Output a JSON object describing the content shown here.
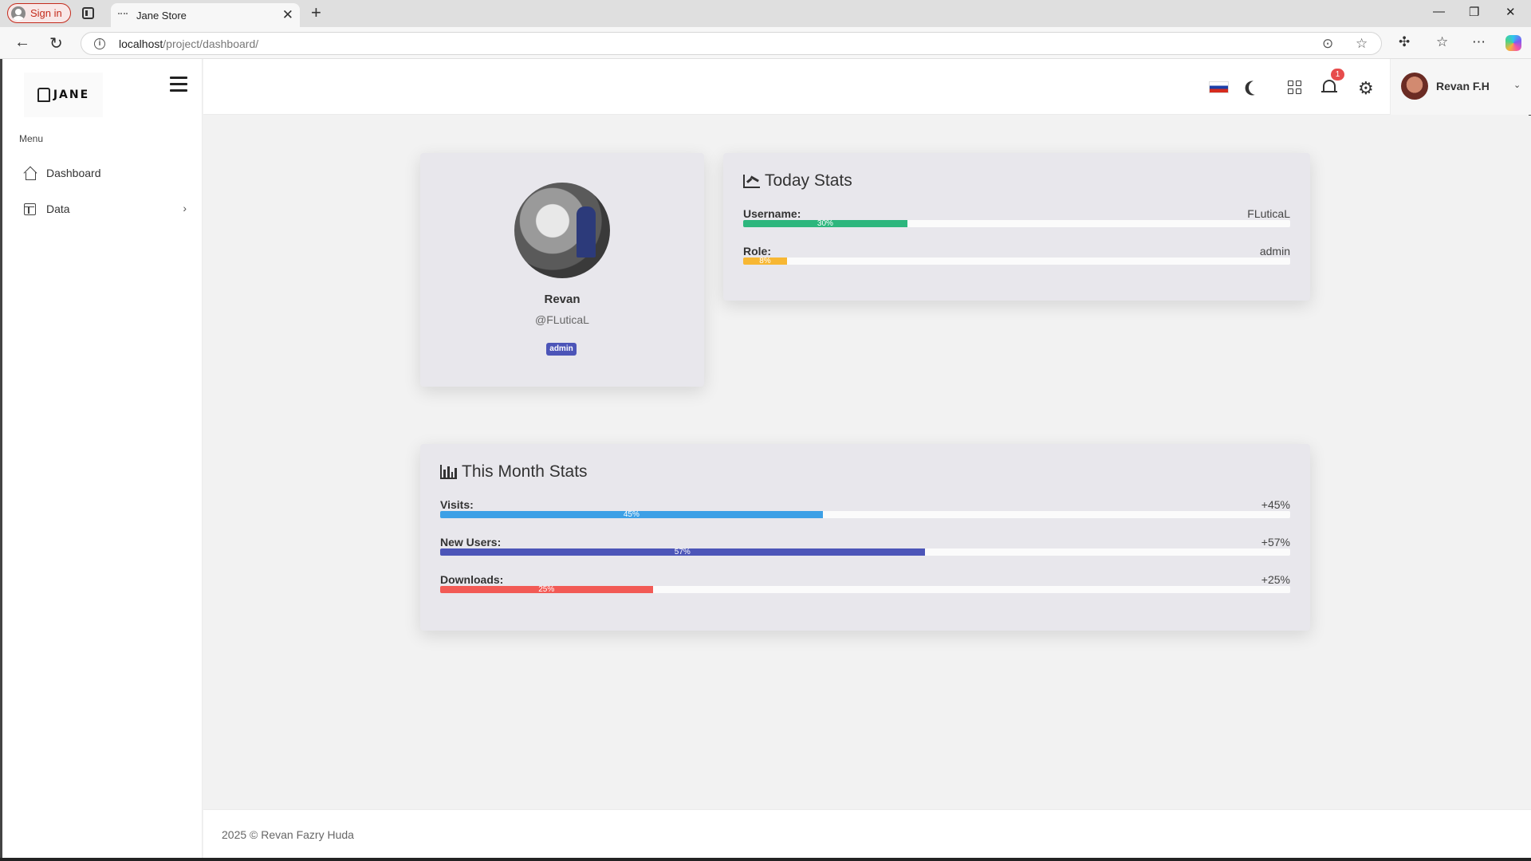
{
  "browser": {
    "signin_label": "Sign in",
    "tab_title": "Jane Store",
    "url_host": "localhost",
    "url_path": "/project/dashboard/"
  },
  "sidebar": {
    "logo_text": "JANE",
    "menu_title": "Menu",
    "items": [
      {
        "label": "Dashboard",
        "icon": "home-icon"
      },
      {
        "label": "Data",
        "icon": "table-icon"
      }
    ]
  },
  "topbar": {
    "notification_count": "1",
    "user_name": "Revan F.H"
  },
  "profile": {
    "name": "Revan",
    "handle": "@FLuticaL",
    "role": "admin"
  },
  "today_stats": {
    "title": "Today Stats",
    "rows": [
      {
        "label": "Username:",
        "value": "FLuticaL",
        "percent": 30,
        "percent_label": "30%",
        "color": "#2db67d"
      },
      {
        "label": "Role:",
        "value": "admin",
        "percent": 8,
        "percent_label": "8%",
        "color": "#f7b733"
      }
    ]
  },
  "month_stats": {
    "title": "This Month Stats",
    "rows": [
      {
        "label": "Visits:",
        "value": "+45%",
        "percent": 45,
        "percent_label": "45%",
        "color": "#3da0e6"
      },
      {
        "label": "New Users:",
        "value": "+57%",
        "percent": 57,
        "percent_label": "57%",
        "color": "#4c55b8"
      },
      {
        "label": "Downloads:",
        "value": "+25%",
        "percent": 25,
        "percent_label": "25%",
        "color": "#f25a55"
      }
    ]
  },
  "footer": {
    "text": "2025 © Revan Fazry Huda"
  }
}
